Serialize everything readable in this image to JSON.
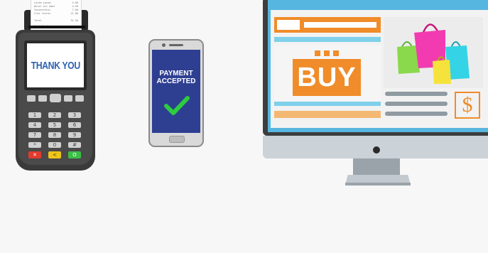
{
  "receipt": {
    "rows": [
      {
        "label": "Lorem ipsum",
        "value": "5.00"
      },
      {
        "label": "Dolor sit amet",
        "value": "4.50"
      },
      {
        "label": "Consectetur",
        "value": "7.00"
      },
      {
        "label": "Cras lectus",
        "value": "21.00"
      }
    ],
    "total_label": "Total",
    "total_value": "91.50",
    "footer": "Bank Card"
  },
  "terminal": {
    "screen_text": "THANK YOU",
    "keypad": [
      "1",
      "2",
      "3",
      "4",
      "5",
      "6",
      "7",
      "8",
      "9",
      "*",
      "0",
      "#"
    ],
    "action_keys": [
      {
        "symbol": "✕",
        "color": "#e23b2e"
      },
      {
        "symbol": "<",
        "color": "#f0c419"
      },
      {
        "symbol": "O",
        "color": "#3bbf45"
      }
    ]
  },
  "phone": {
    "line1": "PAYMENT",
    "line2": "ACCEPTED",
    "check_color": "#2ecc40"
  },
  "monitor": {
    "buy_label": "BUY",
    "price_symbol": "$",
    "accent": "#f08c2a",
    "screen_color": "#57b6e0"
  }
}
